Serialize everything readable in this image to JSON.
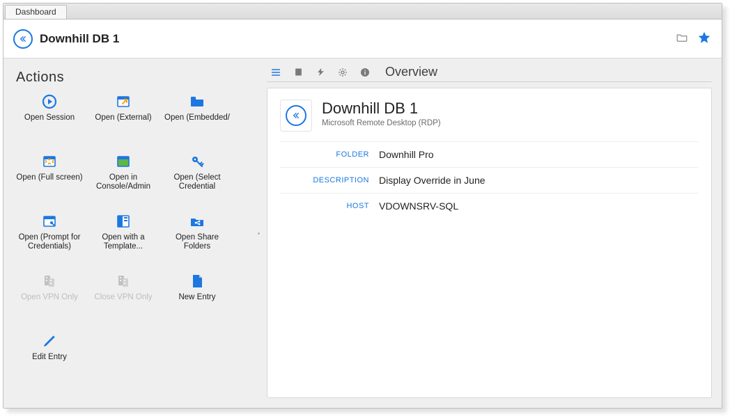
{
  "tabs": {
    "dashboard": "Dashboard"
  },
  "header": {
    "title": "Downhill DB 1"
  },
  "actions": {
    "title": "Actions",
    "items": [
      {
        "id": "open-session",
        "label": "Open Session",
        "icon": "play",
        "enabled": true
      },
      {
        "id": "open-external",
        "label": "Open (External)",
        "icon": "external",
        "enabled": true
      },
      {
        "id": "open-embedded",
        "label": "Open (Embedded/",
        "icon": "folder",
        "enabled": true
      },
      {
        "id": "open-full",
        "label": "Open (Full screen)",
        "icon": "fullscreen",
        "enabled": true
      },
      {
        "id": "open-console",
        "label": "Open in Console/Admin",
        "icon": "console",
        "enabled": true
      },
      {
        "id": "open-select-cred",
        "label": "Open (Select Credential",
        "icon": "key",
        "enabled": true
      },
      {
        "id": "open-prompt-cred",
        "label": "Open (Prompt for Credentials)",
        "icon": "prompt",
        "enabled": true
      },
      {
        "id": "open-template",
        "label": "Open with a Template...",
        "icon": "template",
        "enabled": true
      },
      {
        "id": "open-share",
        "label": "Open Share Folders",
        "icon": "share",
        "enabled": true
      },
      {
        "id": "open-vpn",
        "label": "Open VPN Only",
        "icon": "vpn",
        "enabled": false
      },
      {
        "id": "close-vpn",
        "label": "Close VPN Only",
        "icon": "vpn-close",
        "enabled": false
      },
      {
        "id": "new-entry",
        "label": "New Entry",
        "icon": "new",
        "enabled": true
      },
      {
        "id": "edit-entry",
        "label": "Edit Entry",
        "icon": "pencil",
        "enabled": true
      }
    ]
  },
  "overview": {
    "heading": "Overview",
    "entry": {
      "title": "Downhill DB 1",
      "subtype": "Microsoft Remote Desktop (RDP)",
      "fields": [
        {
          "label": "FOLDER",
          "value": "Downhill Pro"
        },
        {
          "label": "DESCRIPTION",
          "value": "Display Override in June"
        },
        {
          "label": "HOST",
          "value": "VDOWNSRV-SQL"
        }
      ]
    }
  }
}
